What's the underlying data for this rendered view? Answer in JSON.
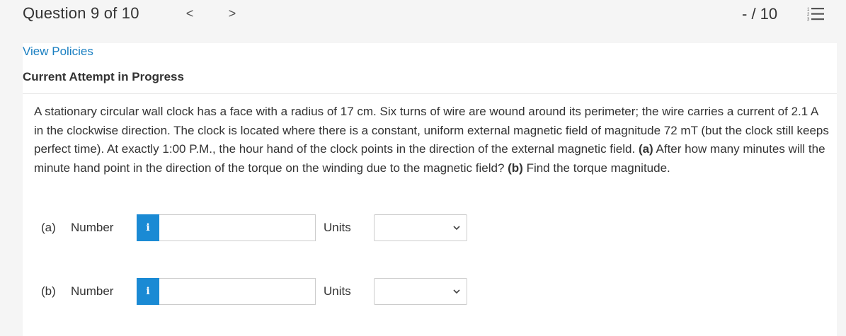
{
  "header": {
    "question_title": "Question 9 of 10",
    "prev_glyph": "<",
    "next_glyph": ">",
    "score": "- / 10",
    "list_icon": "numbered-list-icon"
  },
  "policies": {
    "link_label": "View Policies"
  },
  "attempt": {
    "heading": "Current Attempt in Progress"
  },
  "question": {
    "text_1": "A stationary circular wall clock has a face with a radius of 17 cm. Six turns of wire are wound around its perimeter; the wire carries a current of 2.1 A in the clockwise direction. The clock is located where there is a constant, uniform external magnetic field of magnitude 72 mT (but the clock still keeps perfect time). At exactly 1:00 P.M., the hour hand of the clock points in the direction of the external magnetic field. ",
    "part_a_marker": "(a)",
    "text_2": " After how many minutes will the minute hand point in the direction of the torque on the winding due to the magnetic field? ",
    "part_b_marker": "(b)",
    "text_3": " Find the torque magnitude."
  },
  "answers": [
    {
      "part_label": "(a)",
      "number_label": "Number",
      "info_glyph": "i",
      "number_value": "",
      "units_label": "Units",
      "units_selected": ""
    },
    {
      "part_label": "(b)",
      "number_label": "Number",
      "info_glyph": "i",
      "number_value": "",
      "units_label": "Units",
      "units_selected": ""
    }
  ],
  "colors": {
    "link": "#1a7fc1",
    "info_button": "#1a8ad4",
    "page_background": "#f5f5f5"
  }
}
